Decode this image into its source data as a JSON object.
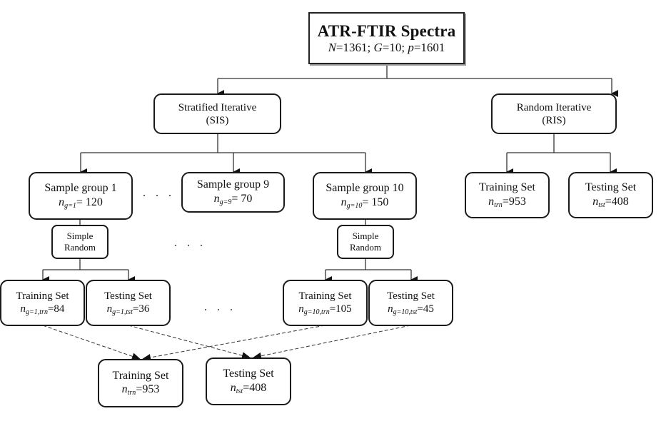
{
  "root": {
    "title": "ATR-FTIR Spectra",
    "params": [
      {
        "var": "N",
        "value": "=1361; "
      },
      {
        "var": "G",
        "value": "=10; "
      },
      {
        "var": "p",
        "value": "=1601"
      }
    ]
  },
  "sis": {
    "line1": "Stratified Iterative",
    "line2": "(SIS)"
  },
  "ris": {
    "line1": "Random Iterative",
    "line2": "(RIS)"
  },
  "groups": [
    {
      "label": "Sample group 1",
      "n_var": "n",
      "n_sub": "g=1",
      "n_value": "= 120"
    },
    {
      "label": "Sample group 9",
      "n_var": "n",
      "n_sub": "g=9",
      "n_value": "= 70"
    },
    {
      "label": "Sample group 10",
      "n_var": "n",
      "n_sub": "g=10",
      "n_value": "= 150"
    }
  ],
  "simple_random": {
    "line1": "Simple",
    "line2": "Random"
  },
  "group_splits": {
    "g1": {
      "train": {
        "label": "Training Set",
        "n_var": "n",
        "n_sub": "g=1,trn",
        "n_value": "=84"
      },
      "test": {
        "label": "Testing Set",
        "n_var": "n",
        "n_sub": "g=1,tst",
        "n_value": "=36"
      }
    },
    "g10": {
      "train": {
        "label": "Training Set",
        "n_var": "n",
        "n_sub": "g=10,trn",
        "n_value": "=105"
      },
      "test": {
        "label": "Testing Set",
        "n_var": "n",
        "n_sub": "g=10,tst",
        "n_value": "=45"
      }
    }
  },
  "ris_split": {
    "train": {
      "label": "Training Set",
      "n_var": "n",
      "n_sub": "trn",
      "n_value": "=953"
    },
    "test": {
      "label": "Testing Set",
      "n_var": "n",
      "n_sub": "tst",
      "n_value": "=408"
    }
  },
  "sis_final": {
    "train": {
      "label": "Training Set",
      "n_var": "n",
      "n_sub": "trn",
      "n_value": "=953"
    },
    "test": {
      "label": "Testing Set",
      "n_var": "n",
      "n_sub": "tst",
      "n_value": "=408"
    }
  },
  "ellipsis": ". . ."
}
